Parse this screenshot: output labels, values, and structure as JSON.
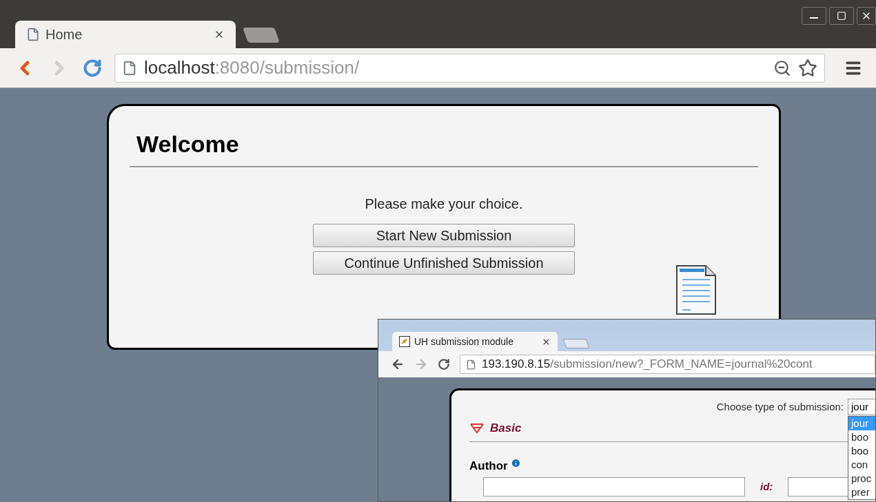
{
  "window": {
    "tab": {
      "title": "Home"
    },
    "address": {
      "host": "localhost",
      "path": ":8080/submission/"
    }
  },
  "page": {
    "heading": "Welcome",
    "prompt": "Please make your choice.",
    "buttons": [
      "Start New Submission",
      "Continue Unfinished Submission"
    ]
  },
  "inset_window": {
    "tab": {
      "title": "UH submission module"
    },
    "address": {
      "host": "193.190.8.15",
      "path": "/submission/new?_FORM_NAME=journal%20cont"
    },
    "type_label": "Choose type of submission:",
    "type_value": "jour",
    "options": [
      {
        "label": "jour",
        "selected": true
      },
      {
        "label": "boo",
        "selected": false
      },
      {
        "label": "boo",
        "selected": false
      },
      {
        "label": "con",
        "selected": false
      },
      {
        "label": "proc",
        "selected": false
      },
      {
        "label": "prer",
        "selected": false
      }
    ],
    "section": "Basic",
    "field_label": "Author",
    "id_label": "id:"
  }
}
